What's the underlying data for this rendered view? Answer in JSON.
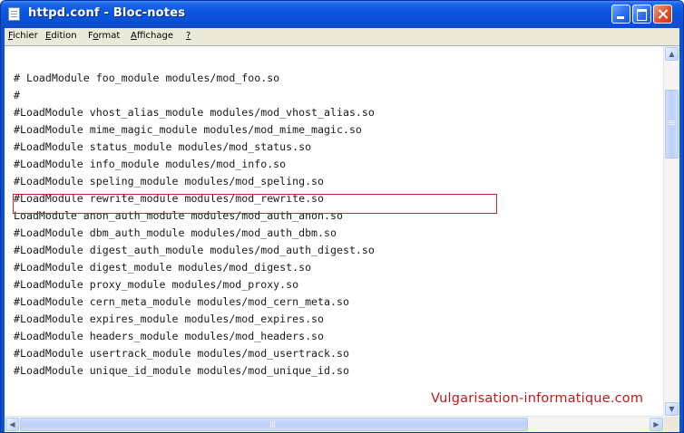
{
  "window": {
    "title": "httpd.conf - Bloc-notes",
    "icons": {
      "app": "notepad-icon",
      "minimize": "minimize-icon",
      "maximize": "maximize-icon",
      "close": "close-icon"
    }
  },
  "menu": [
    {
      "label": "Fichier",
      "mnemonic": "F"
    },
    {
      "label": "Edition",
      "mnemonic": "E"
    },
    {
      "label": "Format",
      "mnemonic": "o"
    },
    {
      "label": "Affichage",
      "mnemonic": "A"
    },
    {
      "label": "?",
      "mnemonic": "?"
    }
  ],
  "editor": {
    "lines": [
      "# LoadModule foo_module modules/mod_foo.so",
      "#",
      "#LoadModule vhost_alias_module modules/mod_vhost_alias.so",
      "#LoadModule mime_magic_module modules/mod_mime_magic.so",
      "#LoadModule status_module modules/mod_status.so",
      "#LoadModule info_module modules/mod_info.so",
      "#LoadModule speling_module modules/mod_speling.so",
      "#LoadModule rewrite_module modules/mod_rewrite.so",
      "LoadModule anon_auth_module modules/mod_auth_anon.so",
      "#LoadModule dbm_auth_module modules/mod_auth_dbm.so",
      "#LoadModule digest_auth_module modules/mod_auth_digest.so",
      "#LoadModule digest_module modules/mod_digest.so",
      "#LoadModule proxy_module modules/mod_proxy.so",
      "#LoadModule cern_meta_module modules/mod_cern_meta.so",
      "#LoadModule expires_module modules/mod_expires.so",
      "#LoadModule headers_module modules/mod_headers.so",
      "#LoadModule usertrack_module modules/mod_usertrack.so",
      "#LoadModule unique_id_module modules/mod_unique_id.so"
    ],
    "highlighted_line": "#LoadModule rewrite_module modules/mod_rewrite.so",
    "highlight_color": "#c8262e",
    "watermark": "Vulgarisation-informatique.com",
    "watermark_color": "#c4161c"
  },
  "scrollbars": {
    "up": "▲",
    "down": "▼",
    "left": "◀",
    "right": "▶"
  },
  "colors": {
    "titlebar": "#0a53d6",
    "menubar": "#ece9d8",
    "text": "#1a1a1a"
  }
}
